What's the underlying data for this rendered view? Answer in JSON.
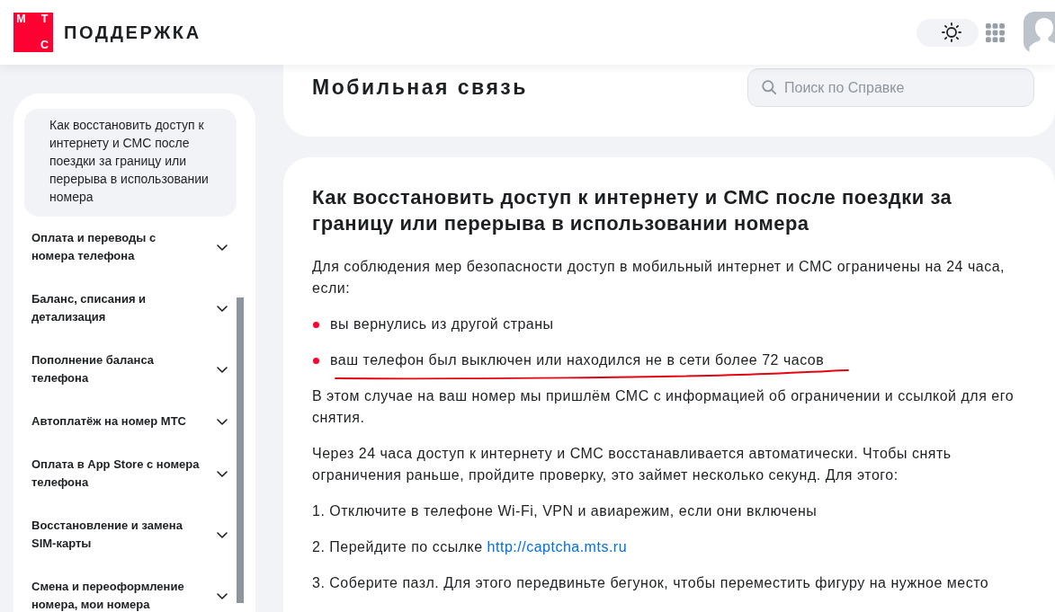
{
  "header": {
    "logo": {
      "letters": [
        "М",
        "Т",
        "С"
      ]
    },
    "title": "ПОДДЕРЖКА",
    "theme_toggle": {
      "on": true
    }
  },
  "sidebar": {
    "items": [
      {
        "kind": "article",
        "label": "Как восстановить доступ к интернету и СМС после поездки за границу или перерыва в использовании номера",
        "selected": true
      },
      {
        "kind": "category",
        "label": "Оплата и переводы с номера телефона",
        "selected": false,
        "expanded": false
      },
      {
        "kind": "category",
        "label": "Баланс, списания и детализация",
        "selected": false,
        "expanded": false
      },
      {
        "kind": "category",
        "label": "Пополнение баланса телефона",
        "selected": false,
        "expanded": false
      },
      {
        "kind": "category",
        "label": "Автоплатёж на номер МТС",
        "selected": false,
        "expanded": false
      },
      {
        "kind": "category",
        "label": "Оплата в App Store с номера телефона",
        "selected": false,
        "expanded": false
      },
      {
        "kind": "category",
        "label": "Восстановление и замена SIM-карты",
        "selected": false,
        "expanded": false
      },
      {
        "kind": "category",
        "label": "Смена и переоформление номера, мои номера",
        "selected": false,
        "expanded": false
      }
    ]
  },
  "section": {
    "title": "Мобильная связь",
    "search": {
      "placeholder": "Поиск по Справке"
    }
  },
  "article": {
    "title": "Как восстановить доступ к интернету и СМС после поездки за границу или перерыва в использовании номера",
    "blocks": [
      {
        "kind": "paragraph",
        "text": "Для соблюдения мер безопасности доступ в мобильный интернет и СМС ограничены на 24 часа, если:"
      },
      {
        "kind": "bullet",
        "text": "вы вернулись из другой страны",
        "underlined": false
      },
      {
        "kind": "bullet",
        "text": "ваш телефон был выключен или находился не в сети более 72 часов",
        "underlined": true
      },
      {
        "kind": "paragraph",
        "text": "В этом случае на ваш номер мы пришлём СМС с информацией об ограничении и ссылкой для его снятия."
      },
      {
        "kind": "paragraph",
        "text": "Через 24 часа доступ к интернету и СМС восстанавливается автоматически. Чтобы снять ограничения раньше, пройдите проверку, это займет несколько секунд. Для этого:"
      },
      {
        "kind": "paragraph",
        "text": "1. Отключите в телефоне Wi-Fi, VPN и авиарежим, если они включены"
      },
      {
        "kind": "link_paragraph",
        "text": "2. Перейдите по ссылке",
        "link": "http://captcha.mts.ru"
      },
      {
        "kind": "paragraph",
        "text": "3. Соберите пазл. Для этого передвиньте бегунок, чтобы переместить фигуру на нужное место"
      }
    ]
  }
}
